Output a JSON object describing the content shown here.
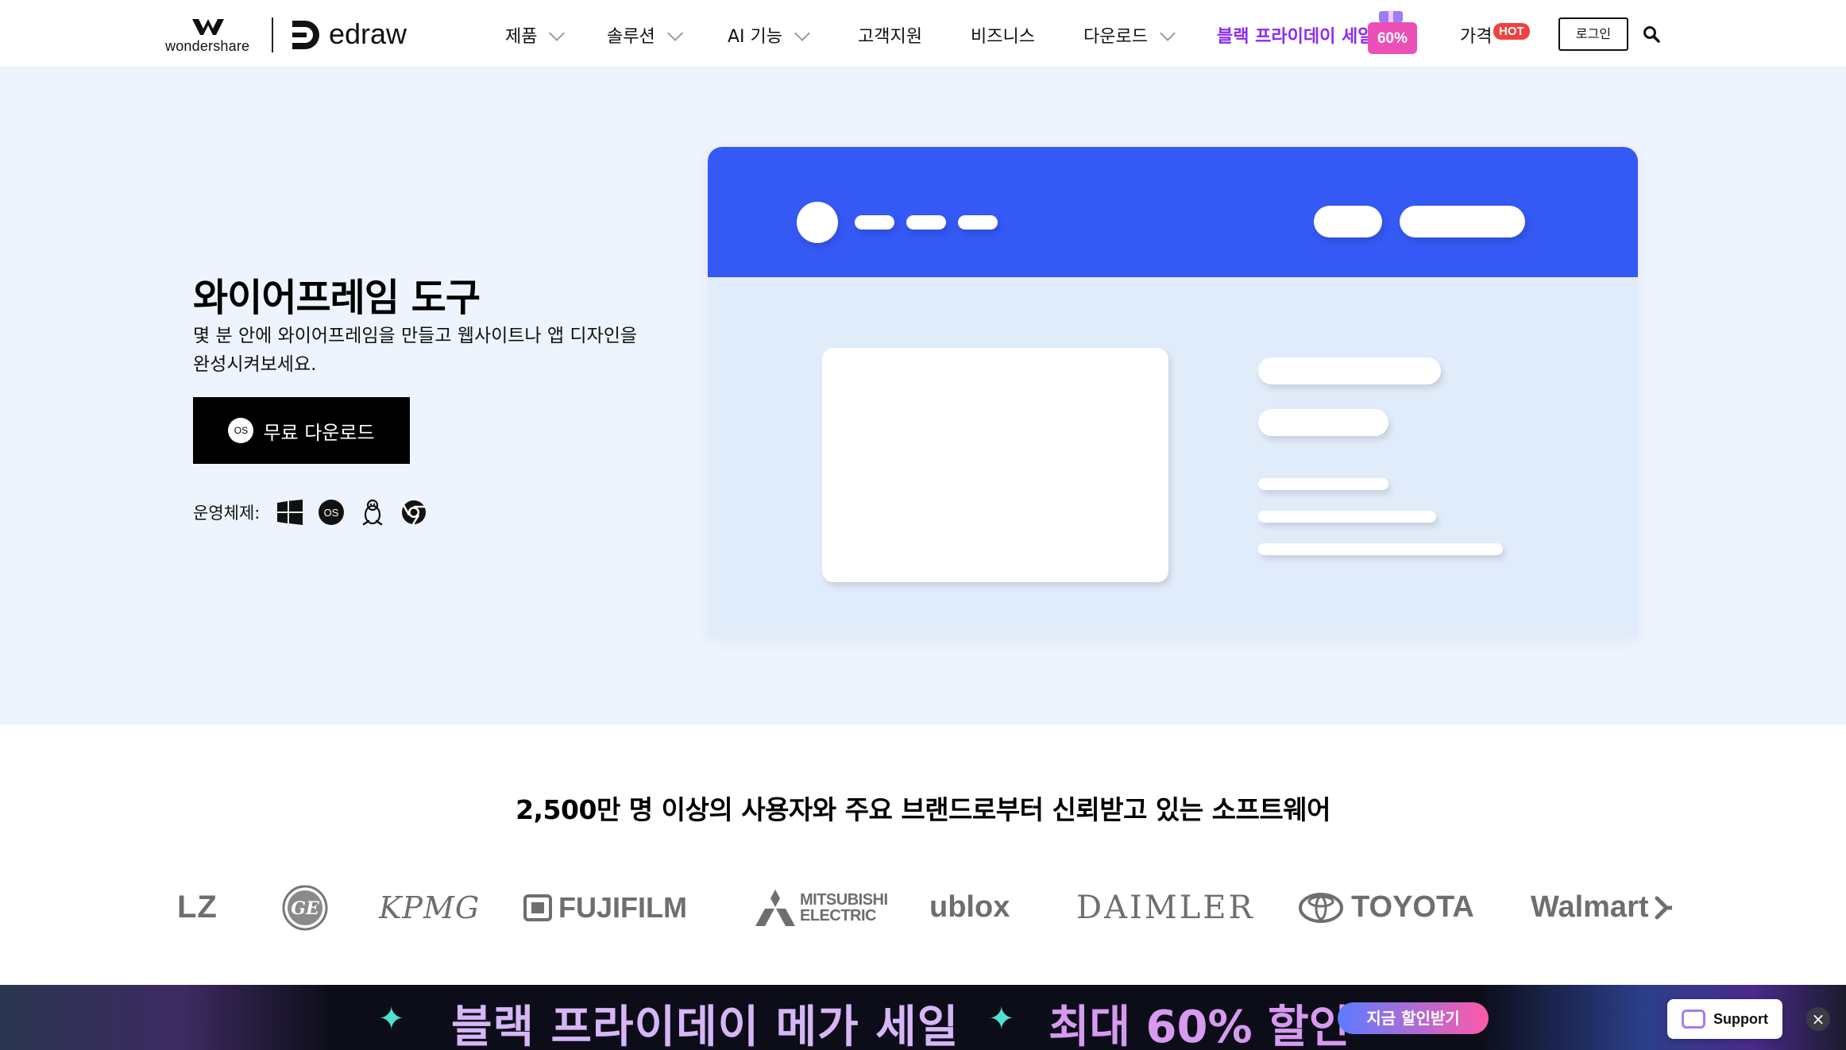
{
  "header": {
    "brand_wondershare": "wondershare",
    "brand_edraw": "edraw",
    "nav": [
      {
        "label": "제품",
        "has_dropdown": true
      },
      {
        "label": "솔루션",
        "has_dropdown": true
      },
      {
        "label": "AI 기능",
        "has_dropdown": true
      },
      {
        "label": "고객지원",
        "has_dropdown": false
      },
      {
        "label": "비즈니스",
        "has_dropdown": false
      },
      {
        "label": "다운로드",
        "has_dropdown": true
      }
    ],
    "sale_label": "블랙 프라이데이 세일",
    "sale_badge": "60%",
    "price_label": "가격",
    "hot_badge": "HOT",
    "login_label": "로그인"
  },
  "hero": {
    "title": "와이어프레임 도구",
    "subtitle_line1": "몇 분 안에 와이어프레임을 만들고 웹사이트나 앱 디자인을",
    "subtitle_line2": "완성시켜보세요.",
    "download_label": "무료 다운로드",
    "download_os_badge": "OS",
    "os_label": "운영체제:",
    "os_icons": [
      "windows-icon",
      "macos-icon",
      "linux-icon",
      "chrome-icon"
    ]
  },
  "trust": {
    "title": "2,500만 명 이상의 사용자와 주요 브랜드로부터 신뢰받고 있는 소프트웨어",
    "brands": [
      "LZ",
      "GE",
      "KPMG",
      "FUJIFILM",
      "MITSUBISHI ELECTRIC",
      "ublox",
      "DAIMLER",
      "TOYOTA",
      "Walmart"
    ]
  },
  "promo": {
    "title": "블랙 프라이데이 메가 세일",
    "highlight": "최대 60% 할인",
    "cta": "지금 할인받기",
    "support": "Support",
    "close": "×"
  },
  "colors": {
    "accent_blue": "#3559f5",
    "hero_bg": "#eef4fd",
    "sale_purple": "#8b2bf5",
    "hot_red": "#f0413f"
  }
}
